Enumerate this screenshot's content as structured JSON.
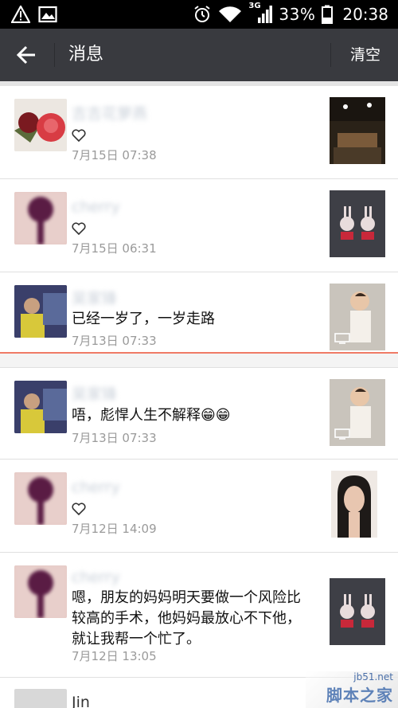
{
  "status_bar": {
    "network": "3G",
    "battery": "33%",
    "time": "20:38"
  },
  "header": {
    "title": "消息",
    "clear_label": "清空"
  },
  "messages": [
    {
      "name": "吉吉花萝燕",
      "heart": true,
      "text": "",
      "time": "7月15日 07:38"
    },
    {
      "name": "cherry",
      "heart": true,
      "text": "",
      "time": "7月15日 06:31"
    },
    {
      "name": "吴家锋",
      "heart": false,
      "text": "已经一岁了，一岁走路",
      "time": "7月13日 07:33"
    },
    {
      "name": "吴家锋",
      "heart": false,
      "text": "唔，彪悍人生不解释😁😁",
      "time": "7月13日 07:33"
    },
    {
      "name": "cherry",
      "heart": true,
      "text": "",
      "time": "7月12日 14:09"
    },
    {
      "name": "cherry",
      "heart": false,
      "text": "嗯，朋友的妈妈明天要做一个风险比较高的手术，他妈妈最放心不下他，就让我帮一个忙了。",
      "time": "7月12日 13:05"
    },
    {
      "name": "Jin",
      "heart": false,
      "text": "",
      "time": ""
    }
  ],
  "watermark": {
    "site": "jb51.net",
    "brand": "脚本之家"
  },
  "colors": {
    "header_bg": "#393a3f",
    "unread_line": "#f07a66",
    "time_text": "#9a9a9a"
  },
  "icons": {
    "back": "arrow-left-icon",
    "like": "heart-outline-icon",
    "video": "video-icon"
  }
}
